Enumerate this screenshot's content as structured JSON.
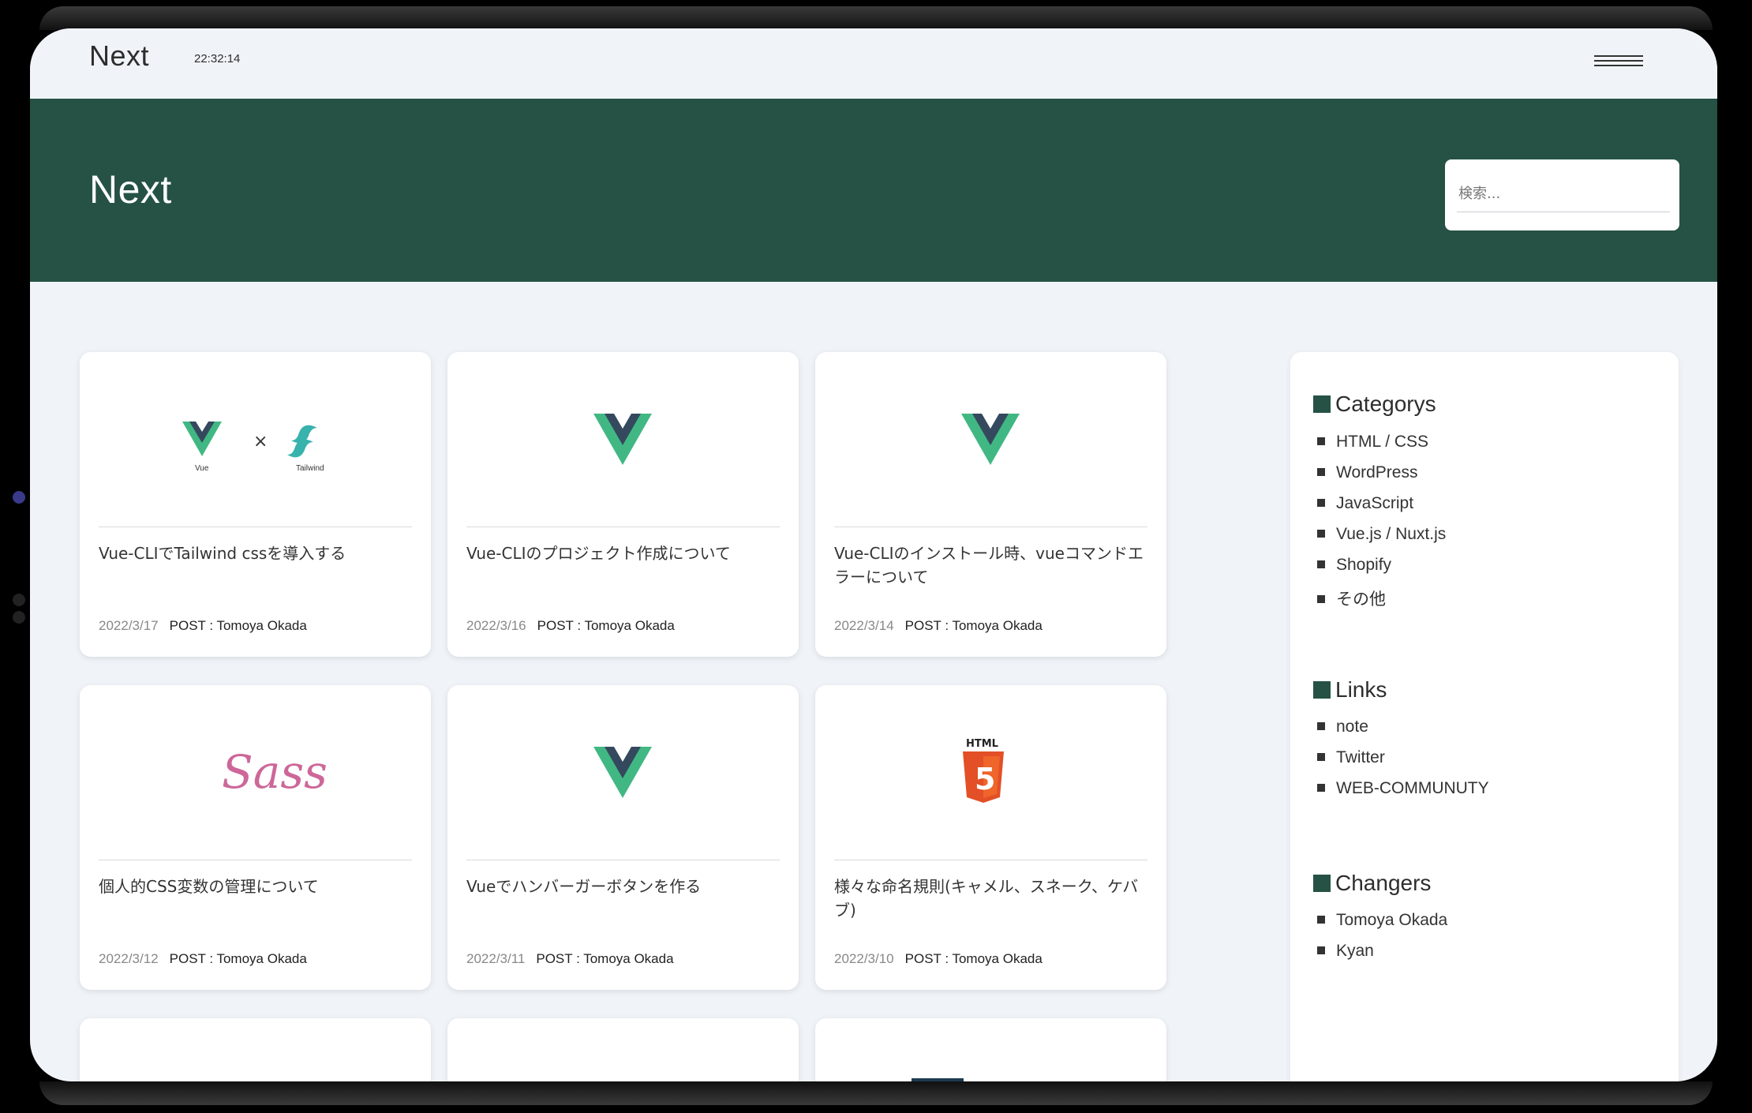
{
  "header": {
    "brand": "Next",
    "clock": "22:32:14"
  },
  "hero": {
    "title": "Next",
    "search_placeholder": "検索..."
  },
  "posts": [
    {
      "title": "Vue-CLIでTailwind cssを導入する",
      "date": "2022/3/17",
      "author": "POST : Tomoya Okada",
      "thumb": "vue-x-tailwind",
      "thumb_labels": {
        "left": "Vue",
        "right": "Tailwind"
      }
    },
    {
      "title": "Vue-CLIのプロジェクト作成について",
      "date": "2022/3/16",
      "author": "POST : Tomoya Okada",
      "thumb": "vue"
    },
    {
      "title": "Vue-CLIのインストール時、vueコマンドエラーについて",
      "date": "2022/3/14",
      "author": "POST : Tomoya Okada",
      "thumb": "vue"
    },
    {
      "title": "個人的CSS変数の管理について",
      "date": "2022/3/12",
      "author": "POST : Tomoya Okada",
      "thumb": "sass"
    },
    {
      "title": "Vueでハンバーガーボタンを作る",
      "date": "2022/3/11",
      "author": "POST : Tomoya Okada",
      "thumb": "vue"
    },
    {
      "title": "様々な命名規則(キャメル、スネーク、ケバブ)",
      "date": "2022/3/10",
      "author": "POST : Tomoya Okada",
      "thumb": "html5"
    }
  ],
  "sidebar": {
    "categories": {
      "heading": "Categorys",
      "items": [
        "HTML / CSS",
        "WordPress",
        "JavaScript",
        "Vue.js / Nuxt.js",
        "Shopify",
        "その他"
      ]
    },
    "links": {
      "heading": "Links",
      "items": [
        "note",
        "Twitter",
        "WEB-COMMUNUTY"
      ]
    },
    "changers": {
      "heading": "Changers",
      "items": [
        "Tomoya Okada",
        "Kyan"
      ]
    }
  },
  "colors": {
    "hero_bg": "#255244",
    "page_bg": "#f0f4f9",
    "vue_green": "#41b883",
    "vue_dark": "#34495e",
    "sass_pink": "#cd6799",
    "html5_orange": "#e34f26",
    "tailwind_teal": "#38b2ac"
  }
}
